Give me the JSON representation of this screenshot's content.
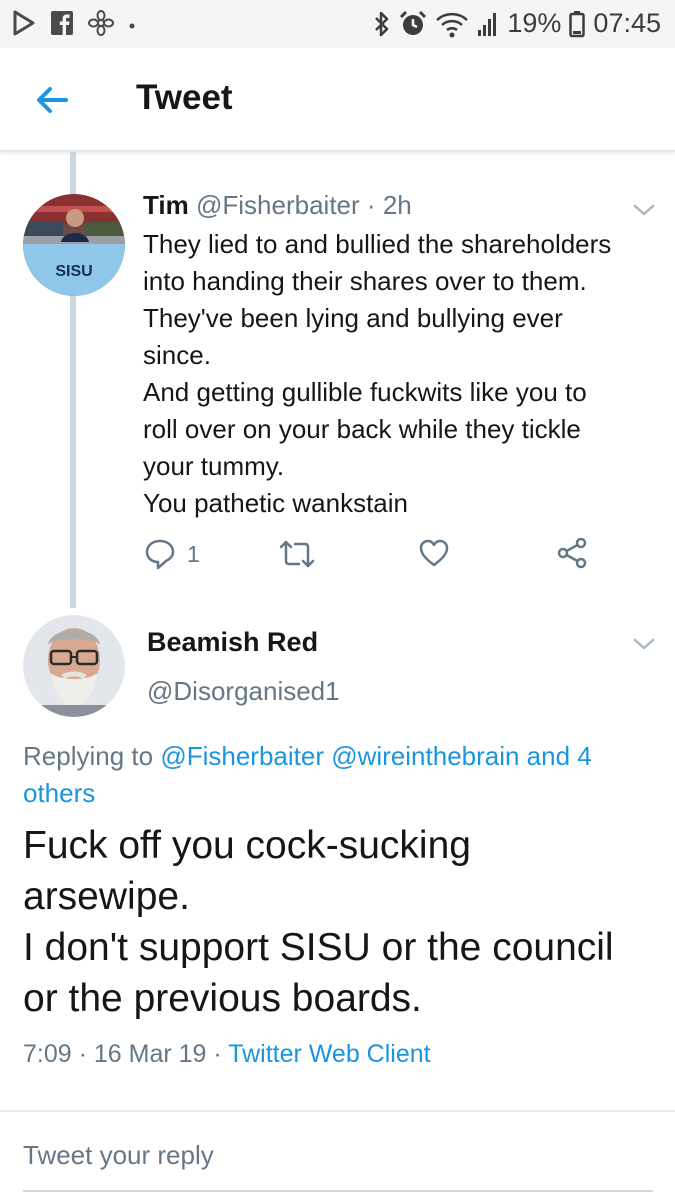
{
  "status_bar": {
    "left_icons": [
      "play-store-icon",
      "facebook-icon",
      "fan-icon",
      "dot-icon"
    ],
    "right_icons": [
      "bluetooth-icon",
      "alarm-icon",
      "wifi-icon",
      "signal-icon",
      "battery-icon"
    ],
    "battery": "19%",
    "time": "07:45"
  },
  "header": {
    "back_icon": "back-arrow-icon",
    "title": "Tweet"
  },
  "parent_tweet": {
    "avatar_text": "SISU",
    "name": "Tim",
    "handle": "@Fisherbaiter",
    "separator": "·",
    "time": "2h",
    "body_lines": [
      "They lied to and bullied the shareholders",
      "into handing their shares over to them.",
      "They've been lying and bullying ever",
      "since.",
      "And getting gullible fuckwits like you to",
      "roll over on your back while they tickle",
      "your tummy.",
      "You pathetic wankstain"
    ],
    "actions": {
      "reply_count": "1",
      "icons": [
        "reply-icon",
        "retweet-icon",
        "like-icon",
        "share-icon"
      ]
    }
  },
  "main_tweet": {
    "name": "Beamish Red",
    "handle": "@Disorganised1",
    "replying_prefix": "Replying to",
    "replying_mentions": "@Fisherbaiter @wireinthebrain and 4",
    "replying_others": "others",
    "body_lines": [
      "Fuck off you cock-sucking",
      "arsewipe.",
      "I don't support SISU or the council",
      "or the previous boards."
    ],
    "timestamp": "7:09 · 16 Mar 19 ·",
    "client": "Twitter Web Client"
  },
  "reply_box": {
    "placeholder": "Tweet your reply"
  },
  "colors": {
    "accent": "#1b95e0",
    "muted": "#657786",
    "text": "#14171a",
    "thread_line": "#ccd6dd"
  }
}
